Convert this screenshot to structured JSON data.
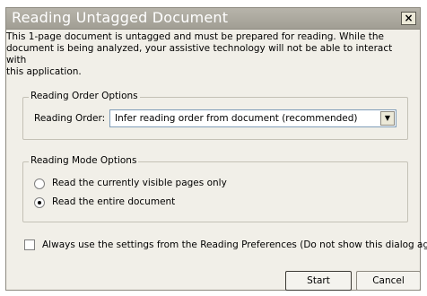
{
  "window": {
    "title": "Reading Untagged Document",
    "close_glyph": "×"
  },
  "intro_text": "This 1-page document is untagged and must be prepared for reading. While the\ndocument is being analyzed, your assistive technology will not be able to interact with\nthis application.",
  "reading_order": {
    "group_label": "Reading Order Options",
    "field_label": "Reading Order:",
    "selected": "Infer reading order from document (recommended)",
    "arrow_glyph": "▼"
  },
  "reading_mode": {
    "group_label": "Reading Mode Options",
    "options": [
      {
        "label": "Read the currently visible pages only",
        "checked": false
      },
      {
        "label": "Read the entire document",
        "checked": true
      }
    ]
  },
  "preferences_checkbox": {
    "label": "Always use the settings from the Reading Preferences (Do not show this dialog again)",
    "checked": false
  },
  "buttons": {
    "start": "Start",
    "cancel": "Cancel"
  },
  "colors": {
    "titlebar": "#a19e94",
    "dialog_bg": "#f1efe8",
    "title_text": "#ffffff"
  }
}
